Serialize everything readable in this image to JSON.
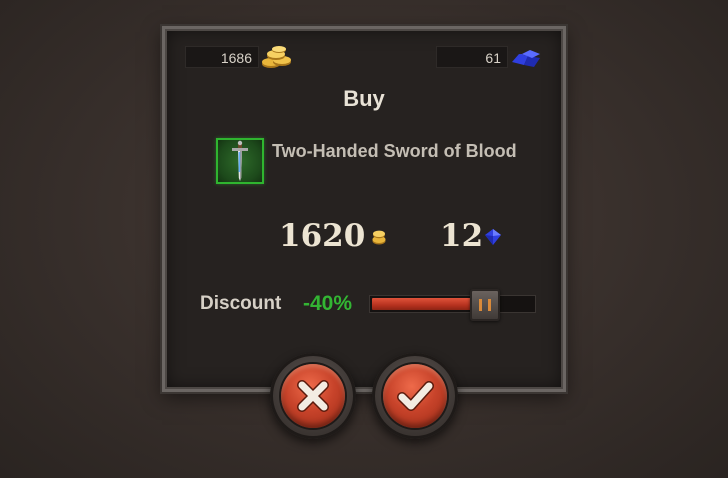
{
  "resources": {
    "gold": "1686",
    "gems": "61"
  },
  "dialog": {
    "title": "Buy",
    "item": {
      "name": "Two-Handed Sword of Blood",
      "icon": "sword-icon",
      "rarity_color": "#2fb52f"
    },
    "price": {
      "gold": "1620",
      "gems": "12"
    },
    "discount": {
      "label": "Discount",
      "value": "-40%",
      "slider_level": 0.7
    },
    "buttons": {
      "cancel_icon": "close-icon",
      "confirm_icon": "check-icon"
    }
  },
  "colors": {
    "accent_red": "#c7432a",
    "discount_green": "#33b533",
    "gold": "#e3b23c",
    "gem_blue": "#2f3fe0"
  }
}
